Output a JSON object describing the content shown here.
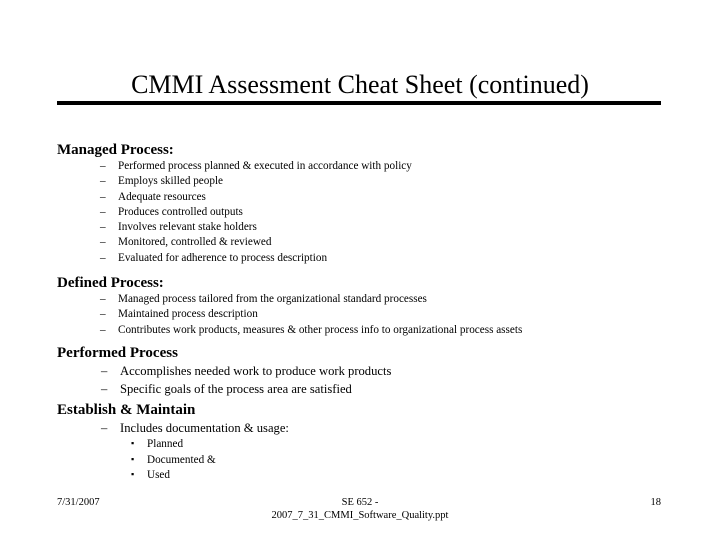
{
  "slide": {
    "title": "CMMI Assessment Cheat Sheet (continued)",
    "sections": [
      {
        "heading": "Managed Process:",
        "bullets": [
          "Performed process planned & executed in accordance with policy",
          "Employs skilled people",
          "Adequate resources",
          "Produces controlled outputs",
          "Involves relevant stake holders",
          "Monitored, controlled & reviewed",
          "Evaluated for adherence to process description"
        ]
      },
      {
        "heading": "Defined Process:",
        "bullets": [
          "Managed process tailored from the organizational standard processes",
          "Maintained process description",
          "Contributes work products, measures & other process info to organizational process assets"
        ]
      },
      {
        "heading": "Performed Process",
        "bullets": [
          "Accomplishes needed work to produce work products",
          "Specific goals of the process area are satisfied"
        ]
      },
      {
        "heading": "Establish & Maintain",
        "bullets": [
          "Includes documentation & usage:"
        ],
        "subbullets": [
          "Planned",
          "Documented &",
          "Used"
        ]
      }
    ],
    "bullet_marker_level2": "–",
    "bullet_marker_level3": "▪"
  },
  "footer": {
    "date": "7/31/2007",
    "center_line1": "SE 652 -",
    "center_line2": "2007_7_31_CMMI_Software_Quality.ppt",
    "page_number": "18"
  },
  "colors": {
    "background": "#ffffff",
    "text": "#000000",
    "rule": "#000000"
  }
}
